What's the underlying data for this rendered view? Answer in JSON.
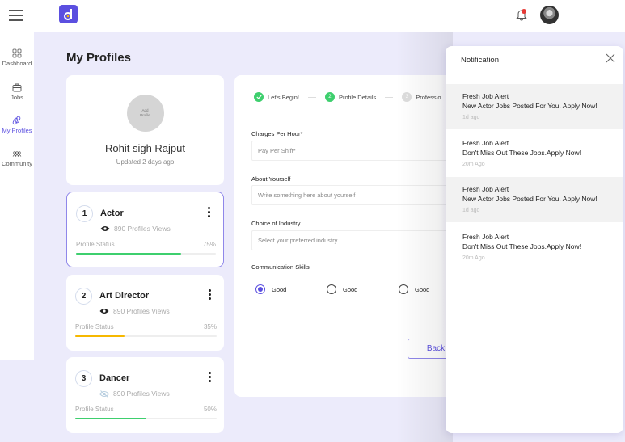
{
  "topbar": {
    "menu_icon": "hamburger-icon",
    "logo_icon": "d-logo-icon",
    "notification_icon": "bell-icon",
    "avatar_icon": "user-avatar"
  },
  "sidebar": {
    "items": [
      {
        "label": "Dashboard",
        "icon": "grid-icon",
        "active": false
      },
      {
        "label": "Jobs",
        "icon": "briefcase-icon",
        "active": false
      },
      {
        "label": "My Profiles",
        "icon": "profiles-icon",
        "active": true
      },
      {
        "label": "Community",
        "icon": "community-icon",
        "active": false
      }
    ]
  },
  "page": {
    "title": "My Profiles"
  },
  "profile": {
    "add_photo_line1": "Add",
    "add_photo_line2": "Profile",
    "name": "Rohit sigh Rajput",
    "updated": "Updated 2 days ago"
  },
  "roles": [
    {
      "num": "1",
      "title": "Actor",
      "views": "890 Profiles Views",
      "visible": true,
      "status_label": "Profile Status",
      "percent": 75,
      "percent_label": "75%",
      "color": "#3ecf6e"
    },
    {
      "num": "2",
      "title": "Art Director",
      "views": "890 Profiles Views",
      "visible": true,
      "status_label": "Profile Status",
      "percent": 35,
      "percent_label": "35%",
      "color": "#f6b800"
    },
    {
      "num": "3",
      "title": "Dancer",
      "views": "890 Profiles Views",
      "visible": false,
      "status_label": "Profile Status",
      "percent": 50,
      "percent_label": "50%",
      "color": "#3ecf6e"
    }
  ],
  "form": {
    "steps": [
      {
        "num": "✓",
        "label": "Let's Begin!",
        "state": "done"
      },
      {
        "num": "2",
        "label": "Profile Details",
        "state": "current"
      },
      {
        "num": "3",
        "label": "Professio",
        "state": "pending"
      }
    ],
    "charges_label": "Charges Per Hour*",
    "charges_placeholder": "Pay Per Shift*",
    "about_label": "About Yourself",
    "about_placeholder": "Write something here about yourself",
    "industry_label": "Choice of Industry",
    "industry_placeholder": "Select your preferred industry",
    "comm_label": "Communication Skills",
    "comm_options": [
      {
        "label": "Good",
        "selected": true
      },
      {
        "label": "Good",
        "selected": false
      },
      {
        "label": "Good",
        "selected": false
      }
    ],
    "back_label": "Back"
  },
  "notifications": {
    "title": "Notification",
    "items": [
      {
        "title": "Fresh Job Alert",
        "body": "New Actor Jobs Posted For You. Apply Now!",
        "time": "1d ago",
        "shaded": true
      },
      {
        "title": "Fresh Job Alert",
        "body": "Don't Miss Out These Jobs.Apply Now!",
        "time": "20m Ago",
        "shaded": false
      },
      {
        "title": "Fresh Job Alert",
        "body": "New Actor Jobs Posted For You. Apply Now!",
        "time": "1d ago",
        "shaded": true
      },
      {
        "title": "Fresh Job Alert",
        "body": "Don't Miss Out These Jobs.Apply Now!",
        "time": "20m Ago",
        "shaded": false
      }
    ]
  },
  "colors": {
    "accent": "#5b4fe0",
    "background": "#ecebfb",
    "success": "#3ecf6e",
    "warning": "#f6b800",
    "badge": "#e53935"
  }
}
